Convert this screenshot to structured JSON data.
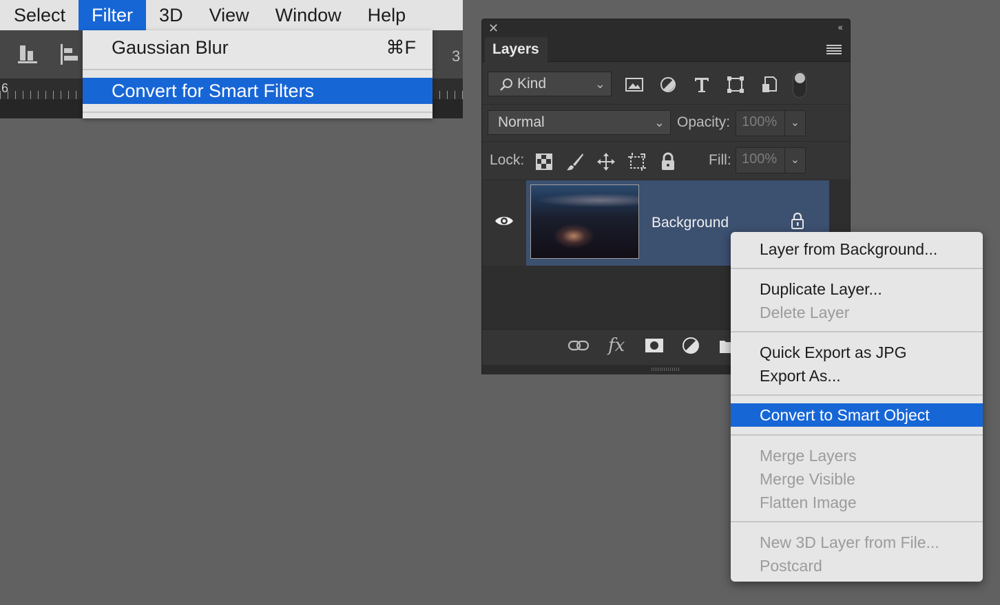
{
  "menubar": {
    "items": [
      {
        "label": "Select"
      },
      {
        "label": "Filter"
      },
      {
        "label": "3D"
      },
      {
        "label": "View"
      },
      {
        "label": "Window"
      },
      {
        "label": "Help"
      }
    ],
    "active": "Filter"
  },
  "ruler": {
    "left_number": "6",
    "right_number": "3"
  },
  "filter_menu": {
    "last_filter": {
      "label": "Gaussian Blur",
      "shortcut": "⌘F"
    },
    "convert_item": {
      "label": "Convert for Smart Filters"
    }
  },
  "layers_panel": {
    "tab": "Layers",
    "kind_filter": {
      "value": "Kind"
    },
    "blend_mode": {
      "value": "Normal"
    },
    "opacity": {
      "label": "Opacity:",
      "value": "100%"
    },
    "lock": {
      "label": "Lock:"
    },
    "fill": {
      "label": "Fill:",
      "value": "100%"
    },
    "layers": [
      {
        "name": "Background",
        "visible": true,
        "locked": true,
        "selected": true
      }
    ],
    "filter_icons": [
      "image-icon",
      "adjustment-icon",
      "type-icon",
      "shape-icon",
      "smart-object-icon"
    ],
    "lock_icons": [
      "lock-transparent-icon",
      "lock-paint-icon",
      "lock-position-icon",
      "lock-artboard-icon",
      "lock-all-icon"
    ],
    "footer_icons": [
      "link-icon",
      "fx-icon",
      "mask-icon",
      "adjustment-layer-icon",
      "folder-icon"
    ]
  },
  "context_menu": {
    "items": [
      {
        "label": "Layer from Background...",
        "enabled": true
      },
      {
        "label": "Duplicate Layer...",
        "enabled": true
      },
      {
        "label": "Delete Layer",
        "enabled": false
      },
      {
        "label": "Quick Export as JPG",
        "enabled": true
      },
      {
        "label": "Export As...",
        "enabled": true
      },
      {
        "label": "Convert to Smart Object",
        "enabled": true,
        "selected": true
      },
      {
        "label": "Merge Layers",
        "enabled": false
      },
      {
        "label": "Merge Visible",
        "enabled": false
      },
      {
        "label": "Flatten Image",
        "enabled": false
      },
      {
        "label": "New 3D Layer from File...",
        "enabled": false
      },
      {
        "label": "Postcard",
        "enabled": false
      }
    ]
  },
  "colors": {
    "accent": "#1766d6",
    "workspace": "#616161",
    "panel": "#353535",
    "selected_layer": "#3c5070",
    "menu_bg": "#e6e6e6"
  }
}
